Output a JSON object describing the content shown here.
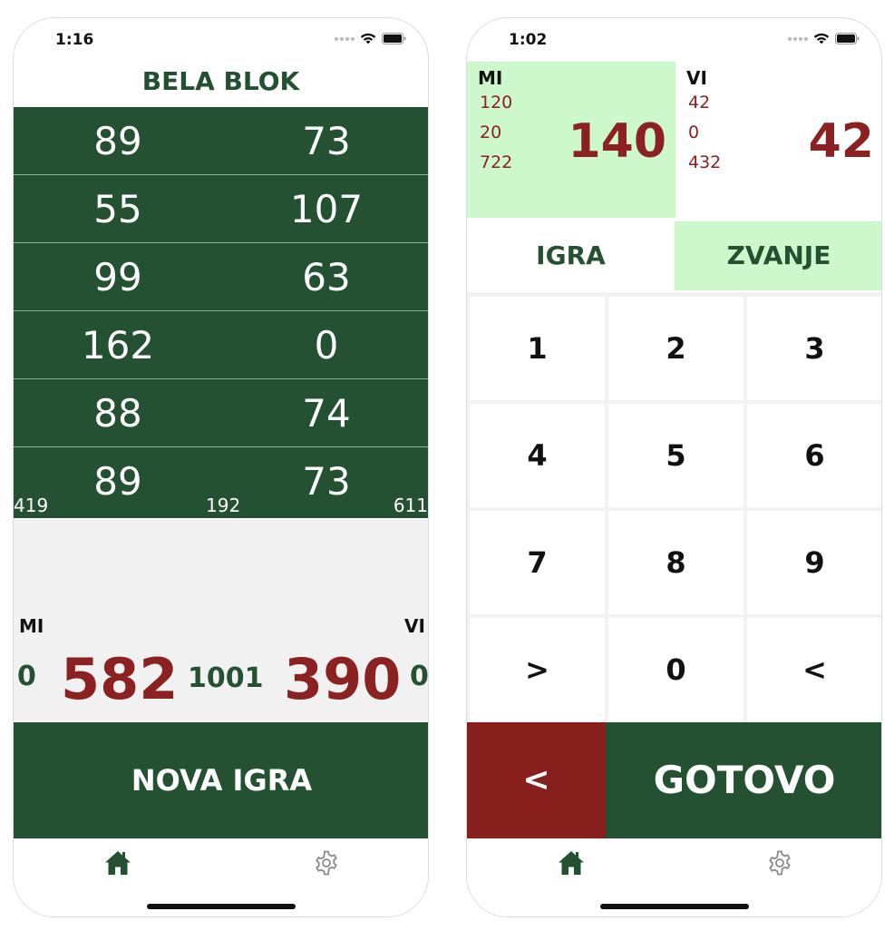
{
  "colors": {
    "dark_green": "#245131",
    "light_green": "#cdf8cb",
    "dark_red": "#8c2121",
    "gray_bg": "#f1f1f1"
  },
  "screen1": {
    "status": {
      "time": "1:16"
    },
    "title": "BELA BLOK",
    "rows": [
      {
        "mi": "89",
        "vi": "73"
      },
      {
        "mi": "55",
        "vi": "107"
      },
      {
        "mi": "99",
        "vi": "63"
      },
      {
        "mi": "162",
        "vi": "0"
      },
      {
        "mi": "88",
        "vi": "74"
      },
      {
        "mi": "89",
        "vi": "73"
      }
    ],
    "subtotals": {
      "left": "419",
      "middle": "192",
      "right": "611"
    },
    "labels": {
      "mi": "MI",
      "vi": "VI"
    },
    "totals": {
      "mi_wins": "0",
      "mi_score": "582",
      "target": "1001",
      "vi_score": "390",
      "vi_wins": "0"
    },
    "new_game_button": "NOVA IGRA",
    "tabs": [
      {
        "name": "home",
        "icon": "home-icon",
        "active": true
      },
      {
        "name": "settings",
        "icon": "gear-icon",
        "active": false
      }
    ]
  },
  "screen2": {
    "status": {
      "time": "1:02"
    },
    "mi": {
      "label": "MI",
      "lines": [
        "120",
        "20",
        "722"
      ],
      "total": "140"
    },
    "vi": {
      "label": "VI",
      "lines": [
        "42",
        "0",
        "432"
      ],
      "total": "42"
    },
    "mode_tabs": {
      "igra": "IGRA",
      "zvanje": "ZVANJE",
      "selected": "zvanje"
    },
    "keys": [
      "1",
      "2",
      "3",
      "4",
      "5",
      "6",
      "7",
      "8",
      "9",
      ">",
      "0",
      "<"
    ],
    "back_button": "<",
    "done_button": "GOTOVO",
    "tabs": [
      {
        "name": "home",
        "icon": "home-icon",
        "active": true
      },
      {
        "name": "settings",
        "icon": "gear-icon",
        "active": false
      }
    ]
  }
}
